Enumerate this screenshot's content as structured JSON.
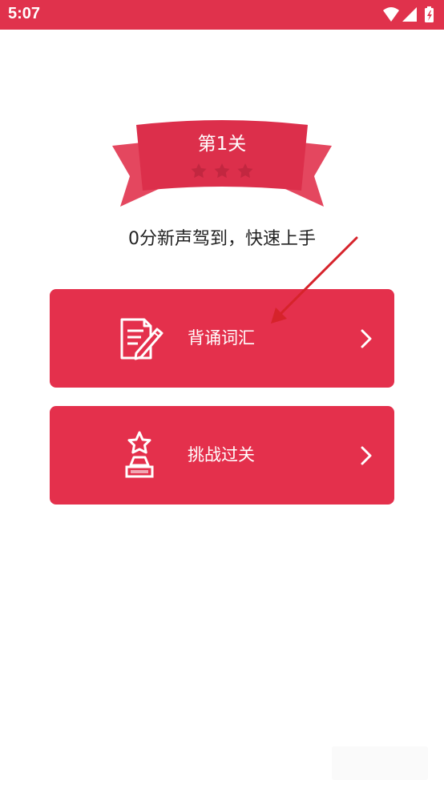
{
  "status_bar": {
    "time": "5:07",
    "icons": [
      "wifi-icon",
      "cellular-signal-icon",
      "battery-charging-icon"
    ]
  },
  "level": {
    "title": "第1关",
    "stars_total": 3,
    "stars_earned": 0,
    "subtitle": "0分新声驾到，快速上手"
  },
  "actions": [
    {
      "label": "背诵词汇",
      "icon": "recite-document-icon"
    },
    {
      "label": "挑战过关",
      "icon": "trophy-star-icon"
    }
  ],
  "colors": {
    "brand": "#e4304c",
    "status_bar": "#e0324c",
    "ribbon_front": "#dc2f4b",
    "ribbon_back": "#e4475f",
    "star_empty": "#c22740",
    "annotation_arrow": "#d6232b"
  }
}
